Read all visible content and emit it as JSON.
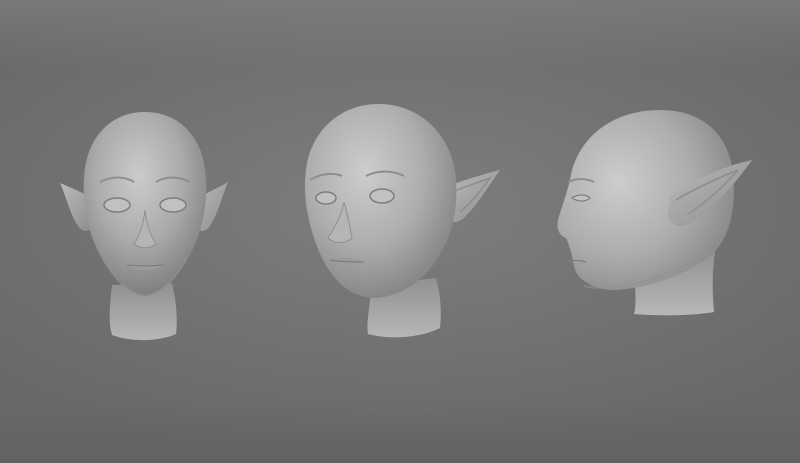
{
  "viewport": {
    "background_color": "#707274",
    "sculpt_color": "#a4a6a8"
  },
  "views": [
    {
      "name": "front"
    },
    {
      "name": "three-quarter"
    },
    {
      "name": "profile"
    }
  ]
}
